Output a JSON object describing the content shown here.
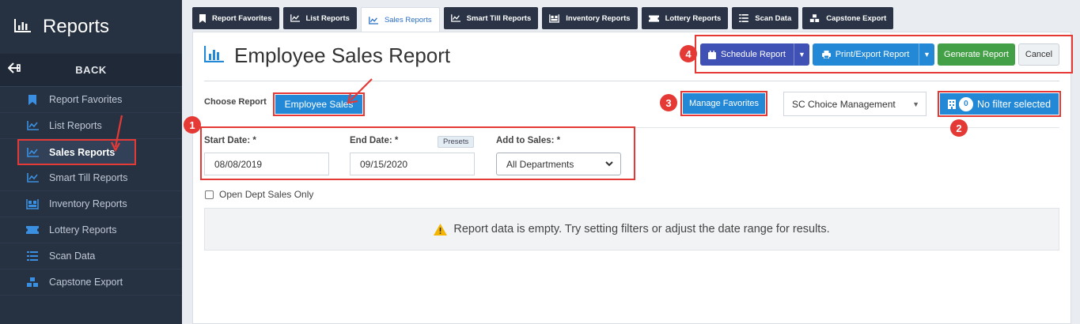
{
  "sidebar": {
    "title": "Reports",
    "back_label": "BACK",
    "items": [
      {
        "label": "Report Favorites",
        "icon": "bookmark-icon"
      },
      {
        "label": "List Reports",
        "icon": "line-chart-icon"
      },
      {
        "label": "Sales Reports",
        "icon": "line-chart-icon"
      },
      {
        "label": "Smart Till Reports",
        "icon": "line-chart-icon"
      },
      {
        "label": "Inventory Reports",
        "icon": "inventory-icon"
      },
      {
        "label": "Lottery Reports",
        "icon": "ticket-icon"
      },
      {
        "label": "Scan Data",
        "icon": "list-icon"
      },
      {
        "label": "Capstone Export",
        "icon": "cubes-icon"
      }
    ],
    "active_index": 2
  },
  "tabs": [
    {
      "label": "Report Favorites",
      "icon": "bookmark-icon"
    },
    {
      "label": "List Reports",
      "icon": "line-chart-icon"
    },
    {
      "label": "Sales Reports",
      "icon": "line-chart-icon"
    },
    {
      "label": "Smart Till Reports",
      "icon": "line-chart-icon"
    },
    {
      "label": "Inventory Reports",
      "icon": "inventory-icon"
    },
    {
      "label": "Lottery Reports",
      "icon": "ticket-icon"
    },
    {
      "label": "Scan Data",
      "icon": "list-icon"
    },
    {
      "label": "Capstone Export",
      "icon": "cubes-icon"
    }
  ],
  "page": {
    "title": "Employee Sales Report"
  },
  "actions": {
    "schedule_label": "Schedule Report",
    "print_label": "Print/Export Report",
    "generate_label": "Generate Report",
    "cancel_label": "Cancel"
  },
  "choose": {
    "label": "Choose Report",
    "selected": "Employee Sales"
  },
  "manage_favorites_label": "Manage Favorites",
  "store_select": {
    "value": "SC Choice Management"
  },
  "filter": {
    "count": "0",
    "label": "No filter selected"
  },
  "fields": {
    "start_label": "Start Date: *",
    "start_value": "08/08/2019",
    "end_label": "End Date: *",
    "end_value": "09/15/2020",
    "presets_label": "Presets",
    "add_label": "Add to Sales: *",
    "add_value": "All Departments"
  },
  "open_dept_label": "Open Dept Sales Only",
  "empty_message": "Report data is empty. Try setting filters or adjust the date range for results.",
  "callouts": [
    "1",
    "2",
    "3",
    "4"
  ],
  "colors": {
    "sidebar_bg": "#263142",
    "primary_blue": "#2389d7",
    "schedule_btn": "#3f51b5",
    "generate_btn": "#43a047",
    "annotation_red": "#e53935"
  }
}
